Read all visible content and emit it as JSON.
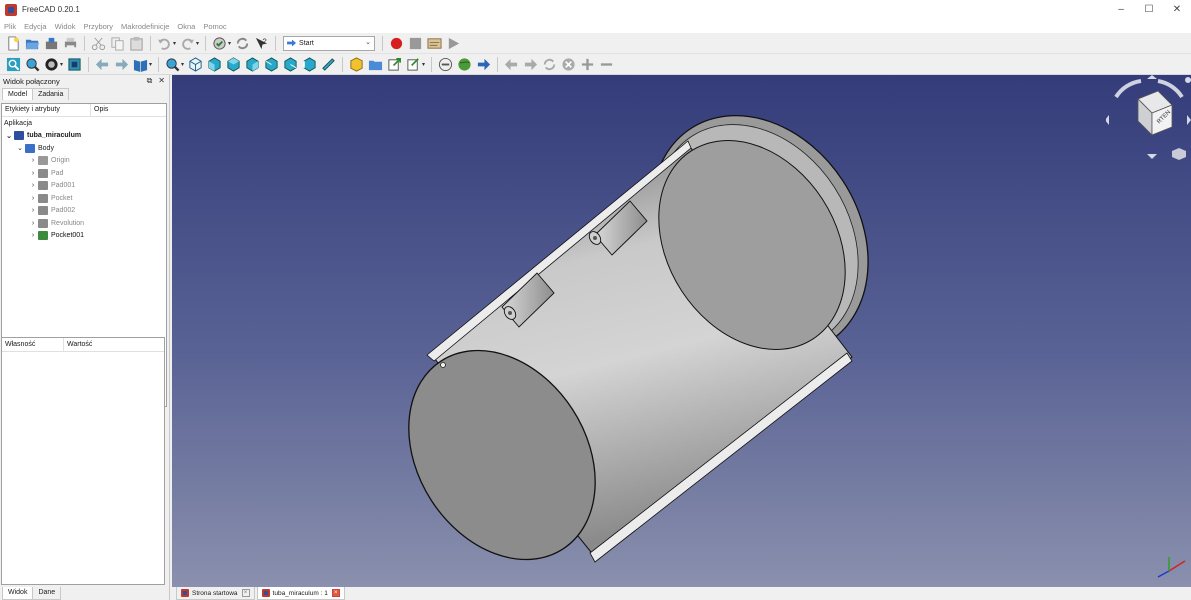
{
  "window": {
    "title": "FreeCAD 0.20.1",
    "minimize_glyph": "–",
    "maximize_glyph": "☐",
    "close_glyph": "✕"
  },
  "menu": [
    "Plik",
    "Edycja",
    "Widok",
    "Przybory",
    "Makrodefinicje",
    "Okna",
    "Pomoc"
  ],
  "toolbar": {
    "workbench_selected": "Start"
  },
  "panel": {
    "title": "Widok połączony",
    "tabs": [
      "Model",
      "Zadania"
    ],
    "tree_columns": [
      "Etykiety i atrybuty",
      "Opis"
    ],
    "tree": [
      {
        "label": "Aplikacja",
        "level": 0,
        "expander": "",
        "icon": "none"
      },
      {
        "label": "tuba_miraculum",
        "level": 1,
        "expander": "⌄",
        "icon": "document-icon"
      },
      {
        "label": "Body",
        "level": 2,
        "expander": "⌄",
        "icon": "body-icon"
      },
      {
        "label": "Origin",
        "level": 3,
        "expander": "›",
        "icon": "origin-icon"
      },
      {
        "label": "Pad",
        "level": 3,
        "expander": "›",
        "icon": "pad-icon"
      },
      {
        "label": "Pad001",
        "level": 3,
        "expander": "›",
        "icon": "pad-icon"
      },
      {
        "label": "Pocket",
        "level": 3,
        "expander": "›",
        "icon": "pocket-icon"
      },
      {
        "label": "Pad002",
        "level": 3,
        "expander": "›",
        "icon": "pad-icon"
      },
      {
        "label": "Revolution",
        "level": 3,
        "expander": "›",
        "icon": "revolution-icon"
      },
      {
        "label": "Pocket001",
        "level": 3,
        "expander": "›",
        "icon": "pocket-active-icon",
        "active": true
      }
    ],
    "property_columns": [
      "Własność",
      "Wartość"
    ],
    "bottom_tabs": [
      "Widok",
      "Dane"
    ]
  },
  "navcube": {
    "face_label": "RTEN"
  },
  "document_tabs": [
    {
      "label": "Strona startowa",
      "active": false
    },
    {
      "label": "tuba_miraculum : 1",
      "active": true
    }
  ]
}
